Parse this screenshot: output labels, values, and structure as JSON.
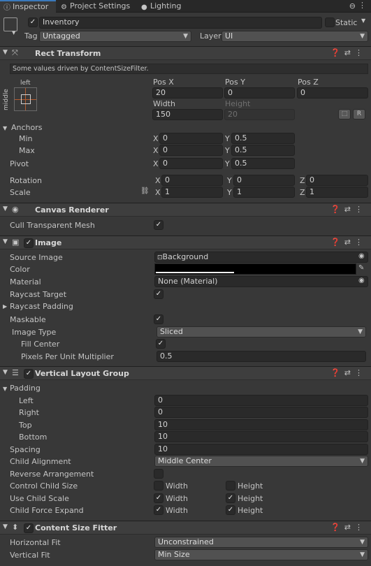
{
  "tabs": [
    {
      "label": "Inspector",
      "icon": "info-icon",
      "active": true
    },
    {
      "label": "Project Settings",
      "icon": "gear-icon",
      "active": false
    },
    {
      "label": "Lighting",
      "icon": "bulb-icon",
      "active": false
    }
  ],
  "object": {
    "name": "Inventory",
    "static_label": "Static",
    "tag_label": "Tag",
    "tag_value": "Untagged",
    "layer_label": "Layer",
    "layer_value": "UI"
  },
  "rect_transform": {
    "title": "Rect Transform",
    "note": "Some values driven by ContentSizeFilter.",
    "anchor_preset_h": "left",
    "anchor_preset_v": "middle",
    "posx_label": "Pos X",
    "posx": "20",
    "posy_label": "Pos Y",
    "posy": "0",
    "posz_label": "Pos Z",
    "posz": "0",
    "width_label": "Width",
    "width": "150",
    "height_label": "Height",
    "height": "20",
    "r_button": "R",
    "anchors_label": "Anchors",
    "min_label": "Min",
    "min_x": "0",
    "min_y": "0.5",
    "max_label": "Max",
    "max_x": "0",
    "max_y": "0.5",
    "pivot_label": "Pivot",
    "pivot_x": "0",
    "pivot_y": "0.5",
    "rotation_label": "Rotation",
    "rot_x": "0",
    "rot_y": "0",
    "rot_z": "0",
    "scale_label": "Scale",
    "scale_x": "1",
    "scale_y": "1",
    "scale_z": "1",
    "x": "X",
    "y": "Y",
    "z": "Z"
  },
  "canvas_renderer": {
    "title": "Canvas Renderer",
    "cull_label": "Cull Transparent Mesh",
    "cull_checked": true
  },
  "image": {
    "title": "Image",
    "source_label": "Source Image",
    "source_value": "Background",
    "color_label": "Color",
    "color_value": "#000000",
    "material_label": "Material",
    "material_value": "None (Material)",
    "raycast_target_label": "Raycast Target",
    "raycast_padding_label": "Raycast Padding",
    "maskable_label": "Maskable",
    "image_type_label": "Image Type",
    "image_type_value": "Sliced",
    "fill_center_label": "Fill Center",
    "ppu_label": "Pixels Per Unit Multiplier",
    "ppu_value": "0.5"
  },
  "vlg": {
    "title": "Vertical Layout Group",
    "padding_label": "Padding",
    "left_label": "Left",
    "left": "0",
    "right_label": "Right",
    "right": "0",
    "top_label": "Top",
    "top": "10",
    "bottom_label": "Bottom",
    "bottom": "10",
    "spacing_label": "Spacing",
    "spacing": "10",
    "child_alignment_label": "Child Alignment",
    "child_alignment": "Middle Center",
    "reverse_label": "Reverse Arrangement",
    "control_label": "Control Child Size",
    "use_scale_label": "Use Child Scale",
    "force_expand_label": "Child Force Expand",
    "width_label": "Width",
    "height_label": "Height"
  },
  "csf": {
    "title": "Content Size Fitter",
    "hfit_label": "Horizontal Fit",
    "hfit": "Unconstrained",
    "vfit_label": "Vertical Fit",
    "vfit": "Min Size"
  },
  "header_icons": [
    "help-icon",
    "preset-icon",
    "kebab-menu-icon"
  ]
}
